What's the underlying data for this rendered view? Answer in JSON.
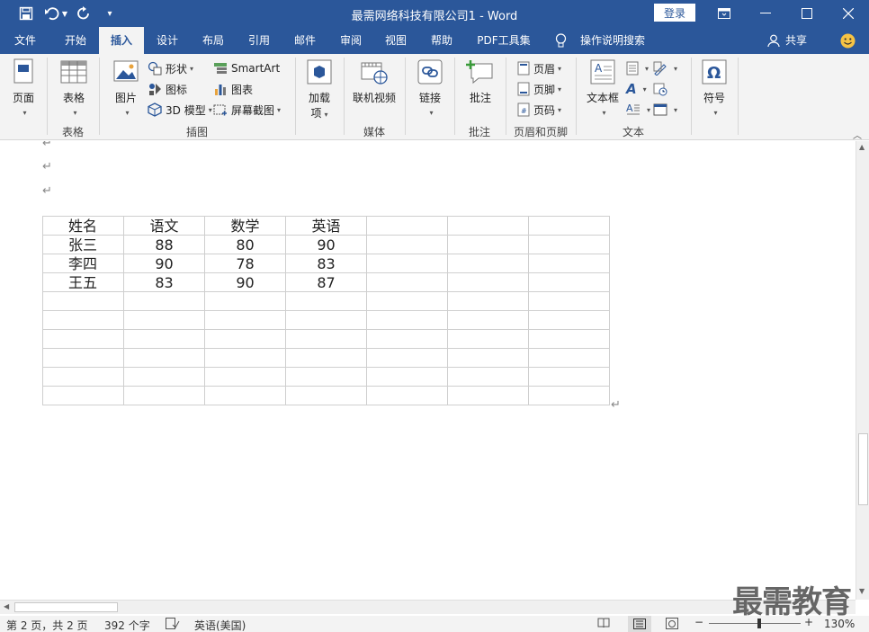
{
  "title_bar": {
    "document_title": "最需网络科技有限公司1  -  Word",
    "login_label": "登录"
  },
  "tabs": [
    {
      "label": "文件"
    },
    {
      "label": "开始"
    },
    {
      "label": "插入",
      "active": true
    },
    {
      "label": "设计"
    },
    {
      "label": "布局"
    },
    {
      "label": "引用"
    },
    {
      "label": "邮件"
    },
    {
      "label": "审阅"
    },
    {
      "label": "视图"
    },
    {
      "label": "帮助"
    },
    {
      "label": "PDF工具集"
    }
  ],
  "tell_me": "操作说明搜索",
  "share_label": "共享",
  "ribbon": {
    "pages": {
      "label": "页面"
    },
    "tables": {
      "button": "表格",
      "group": "表格"
    },
    "illustrations": {
      "group": "插图",
      "picture": "图片",
      "shapes": "形状",
      "icons": "图标",
      "model3d": "3D 模型",
      "smartart": "SmartArt",
      "chart": "图表",
      "screenshot": "屏幕截图"
    },
    "addins": {
      "line1": "加载",
      "line2": "项"
    },
    "media": {
      "button": "联机视频",
      "group": "媒体"
    },
    "links": {
      "button": "链接"
    },
    "comments": {
      "button": "批注",
      "group": "批注"
    },
    "header_footer": {
      "header": "页眉",
      "footer": "页脚",
      "page_number": "页码",
      "group": "页眉和页脚"
    },
    "text": {
      "textbox": "文本框",
      "group": "文本"
    },
    "symbols": {
      "button": "符号"
    }
  },
  "table": {
    "rows": [
      [
        "姓名",
        "语文",
        "数学",
        "英语",
        "",
        "",
        ""
      ],
      [
        "张三",
        "88",
        "80",
        "90",
        "",
        "",
        ""
      ],
      [
        "李四",
        "90",
        "78",
        "83",
        "",
        "",
        ""
      ],
      [
        "王五",
        "83",
        "90",
        "87",
        "",
        "",
        ""
      ],
      [
        "",
        "",
        "",
        "",
        "",
        "",
        ""
      ],
      [
        "",
        "",
        "",
        "",
        "",
        "",
        ""
      ],
      [
        "",
        "",
        "",
        "",
        "",
        "",
        ""
      ],
      [
        "",
        "",
        "",
        "",
        "",
        "",
        ""
      ],
      [
        "",
        "",
        "",
        "",
        "",
        "",
        ""
      ],
      [
        "",
        "",
        "",
        "",
        "",
        "",
        ""
      ]
    ]
  },
  "status": {
    "page": "第 2 页，共 2 页",
    "words": "392 个字",
    "language": "英语(美国)",
    "zoom": "130%"
  },
  "watermark": "最需教育",
  "colors": {
    "accent": "#2b579a",
    "ribbon_bg": "#f3f3f3"
  }
}
